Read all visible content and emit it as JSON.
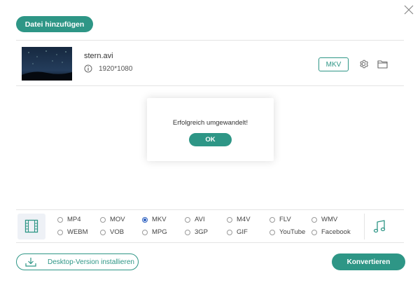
{
  "header": {
    "add_file_label": "Datei hinzufügen",
    "close_icon": "close-icon"
  },
  "file": {
    "name": "stern.avi",
    "resolution": "1920*1080",
    "target_format": "MKV",
    "icons": [
      "info-icon",
      "gear-icon",
      "folder-icon"
    ]
  },
  "dialog": {
    "message": "Erfolgreich umgewandelt!",
    "ok_label": "OK"
  },
  "formats": {
    "selected": "MKV",
    "row1": [
      "MP4",
      "MOV",
      "MKV",
      "AVI",
      "M4V",
      "FLV",
      "WMV"
    ],
    "row2": [
      "WEBM",
      "VOB",
      "MPG",
      "3GP",
      "GIF",
      "YouTube",
      "Facebook"
    ],
    "icons": [
      "film-icon",
      "music-icon"
    ]
  },
  "footer": {
    "desktop_label": "Desktop-Version installieren",
    "convert_label": "Konvertieren"
  },
  "colors": {
    "accent": "#2e9686",
    "radio_selected": "#2b5fc0"
  }
}
